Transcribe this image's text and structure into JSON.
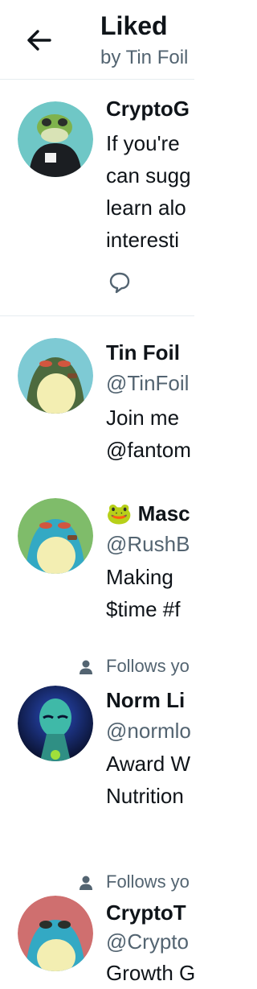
{
  "header": {
    "title": "Liked",
    "subtitle": "by Tin Foil"
  },
  "first_item": {
    "name": "CryptoG",
    "text_lines": [
      "If you're",
      "can sugg",
      "learn alo",
      "interesti"
    ]
  },
  "users": [
    {
      "name": "Tin Foil",
      "handle": "@TinFoil",
      "bio_lines": [
        "Join me",
        "@fantom"
      ],
      "follows": ""
    },
    {
      "name": "🐸 Masc",
      "handle": "@RushB",
      "bio_lines": [
        "Making",
        "$time #f"
      ],
      "follows": ""
    },
    {
      "name": "Norm Li",
      "handle": "@normlo",
      "bio_lines": [
        "Award W",
        "Nutrition"
      ],
      "follows": "Follows yo"
    },
    {
      "name": "CryptoT",
      "handle": "@Crypto",
      "bio_lines": [
        "Growth G"
      ],
      "follows": "Follows yo"
    }
  ],
  "colors": {
    "text_primary": "#0f1419",
    "text_secondary": "#536471",
    "divider": "#e6ecf0"
  },
  "icons": {
    "back": "arrow-left-icon",
    "reply": "speech-bubble-icon",
    "follows": "person-icon"
  }
}
